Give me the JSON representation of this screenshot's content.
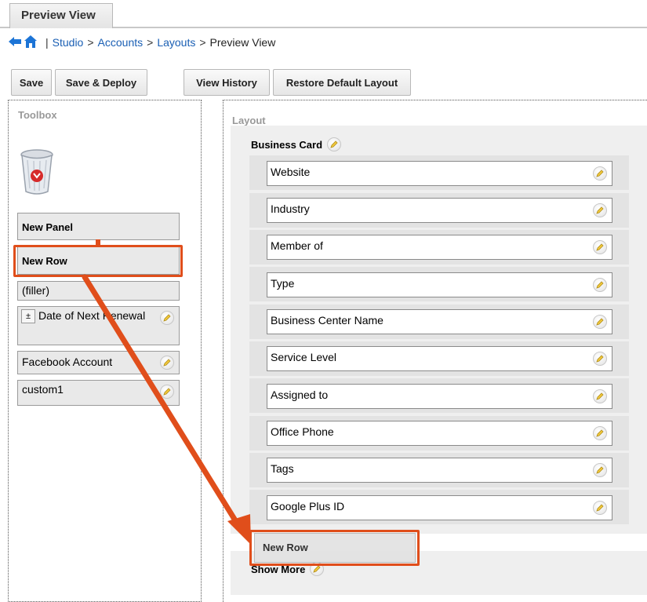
{
  "tab": {
    "label": "Preview View"
  },
  "breadcrumb": {
    "items": [
      "Studio",
      "Accounts",
      "Layouts"
    ],
    "separator": ">",
    "current": "Preview View",
    "divider": "|"
  },
  "toolbar": {
    "save": "Save",
    "save_deploy": "Save & Deploy",
    "view_history": "View History",
    "restore_default": "Restore Default Layout"
  },
  "toolbox": {
    "title": "Toolbox",
    "items": {
      "new_panel": "New Panel",
      "new_row": "New Row",
      "filler": "(filler)",
      "date_of_next_renewal": "Date of Next Renewal",
      "facebook_account": "Facebook Account",
      "custom1": "custom1"
    }
  },
  "layout": {
    "title": "Layout",
    "panel_business_card": "Business Card",
    "fields": [
      "Website",
      "Industry",
      "Member of",
      "Type",
      "Business Center Name",
      "Service Level",
      "Assigned to",
      "Office Phone",
      "Tags",
      "Google Plus ID"
    ],
    "dropped_row": "New Row",
    "panel_show_more": "Show More"
  },
  "colors": {
    "link": "#1a5fb4",
    "highlight": "#e04e1b",
    "panel_bg": "#efefef"
  },
  "icons": [
    "back-arrow-icon",
    "home-icon",
    "trash-icon",
    "pencil-icon",
    "plus-minus-icon",
    "arrow-annotation"
  ]
}
